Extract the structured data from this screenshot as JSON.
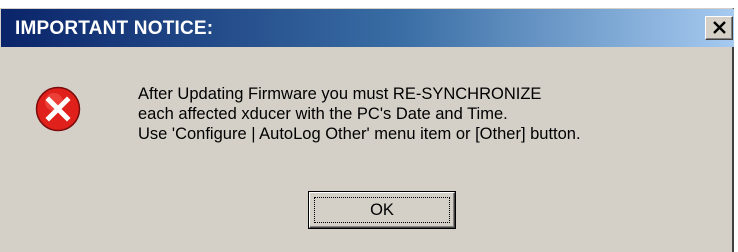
{
  "window": {
    "title": "IMPORTANT NOTICE:",
    "close_icon": "close-icon"
  },
  "message": {
    "icon": "error-icon",
    "lines": [
      "After Updating Firmware you must RE-SYNCHRONIZE",
      "each affected xducer with the PC's Date and Time.",
      "Use 'Configure | AutoLog Other' menu item or [Other] button."
    ]
  },
  "buttons": {
    "ok_label": "OK"
  },
  "colors": {
    "titlebar_start": "#0a246a",
    "titlebar_end": "#a6caf0",
    "dialog_face": "#d4d0c8",
    "error_red": "#e0201b"
  }
}
